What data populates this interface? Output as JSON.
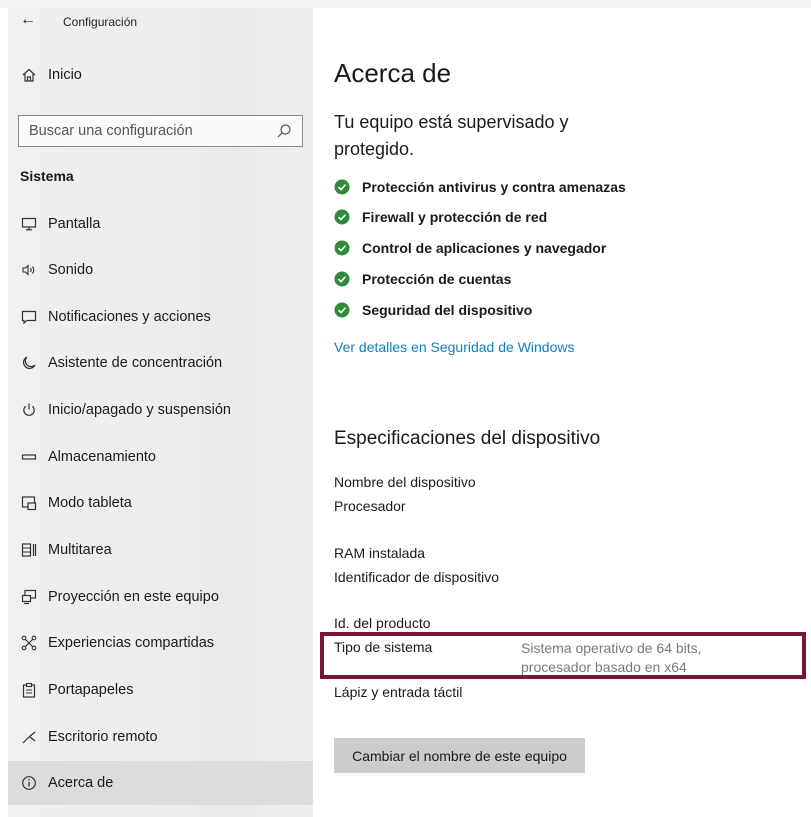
{
  "window": {
    "title": "Configuración"
  },
  "sidebar": {
    "home_label": "Inicio",
    "search_placeholder": "Buscar una configuración",
    "section_title": "Sistema",
    "items": [
      {
        "label": "Pantalla",
        "icon": "monitor-icon"
      },
      {
        "label": "Sonido",
        "icon": "speaker-icon"
      },
      {
        "label": "Notificaciones y acciones",
        "icon": "notification-icon"
      },
      {
        "label": "Asistente de concentración",
        "icon": "moon-icon"
      },
      {
        "label": "Inicio/apagado y suspensión",
        "icon": "power-icon"
      },
      {
        "label": "Almacenamiento",
        "icon": "storage-icon"
      },
      {
        "label": "Modo tableta",
        "icon": "tablet-icon"
      },
      {
        "label": "Multitarea",
        "icon": "multitask-icon"
      },
      {
        "label": "Proyección en este equipo",
        "icon": "projection-icon"
      },
      {
        "label": "Experiencias compartidas",
        "icon": "share-icon"
      },
      {
        "label": "Portapapeles",
        "icon": "clipboard-icon"
      },
      {
        "label": "Escritorio remoto",
        "icon": "remote-desktop-icon"
      },
      {
        "label": "Acerca de",
        "icon": "info-icon",
        "active": true
      }
    ]
  },
  "main": {
    "title": "Acerca de",
    "status_heading": "Tu equipo está supervisado y protegido.",
    "protections": [
      "Protección antivirus y contra amenazas",
      "Firewall y protección de red",
      "Control de aplicaciones y navegador",
      "Protección de cuentas",
      "Seguridad del dispositivo"
    ],
    "security_link": "Ver detalles en Seguridad de Windows",
    "specs_title": "Especificaciones del dispositivo",
    "specs": {
      "device_name": "Nombre del dispositivo",
      "processor": "Procesador",
      "ram": "RAM instalada",
      "device_id": "Identificador de dispositivo",
      "product_id": "Id. del producto",
      "system_type": "Tipo de sistema",
      "system_type_value_line1": "Sistema operativo de 64 bits,",
      "system_type_value_line2": "procesador basado en x64",
      "pen_touch": "Lápiz y entrada táctil"
    },
    "rename_button": "Cambiar el nombre de este equipo"
  },
  "colors": {
    "accent_link": "#0f7fbf",
    "check_green": "#2e8b3a",
    "highlight_border": "#7b1631",
    "sidebar_active": "#dcdcdc"
  }
}
